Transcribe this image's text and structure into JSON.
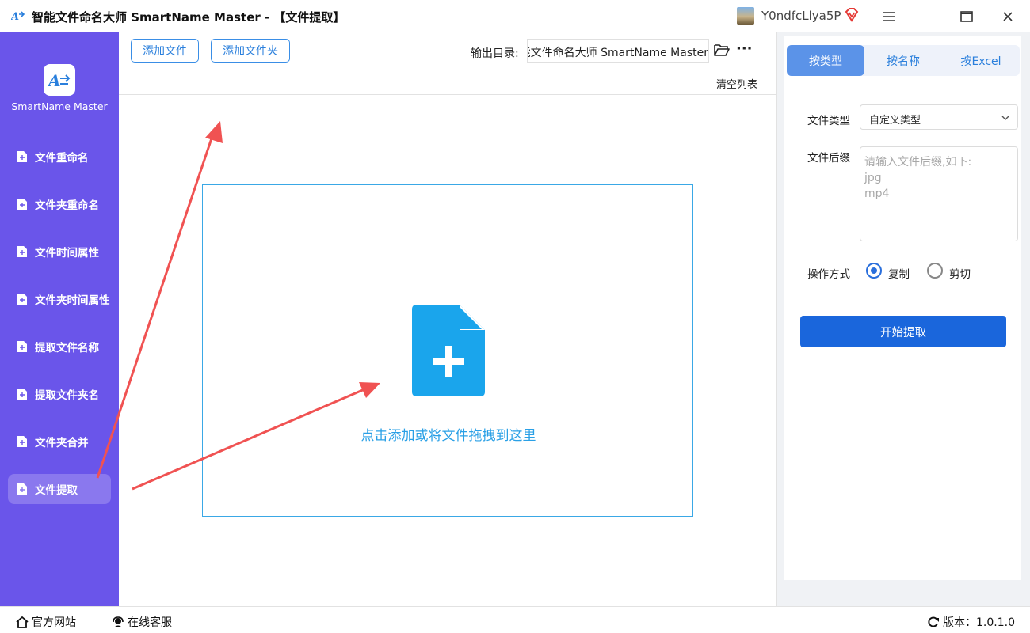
{
  "window": {
    "title": "智能文件命名大师 SmartName Master - 【文件提取】",
    "username": "Y0ndfcLlya5P"
  },
  "sidebar": {
    "brand": "SmartName Master",
    "items": [
      {
        "label": "文件重命名"
      },
      {
        "label": "文件夹重命名"
      },
      {
        "label": "文件时间属性"
      },
      {
        "label": "文件夹时间属性"
      },
      {
        "label": "提取文件名称"
      },
      {
        "label": "提取文件夹名"
      },
      {
        "label": "文件夹合并"
      },
      {
        "label": "文件提取",
        "active": true
      }
    ]
  },
  "toolbar": {
    "add_file": "添加文件",
    "add_folder": "添加文件夹",
    "output_label": "输出目录:",
    "output_path": "能文件命名大师 SmartName Master",
    "clear_list": "清空列表"
  },
  "dropzone": {
    "text": "点击添加或将文件拖拽到这里"
  },
  "right_panel": {
    "tabs": [
      {
        "label": "按类型",
        "active": true
      },
      {
        "label": "按名称"
      },
      {
        "label": "按Excel"
      }
    ],
    "file_type_label": "文件类型",
    "file_type_value": "自定义类型",
    "suffix_label": "文件后缀",
    "suffix_placeholder": "请输入文件后缀,如下:\njpg\nmp4",
    "operation_label": "操作方式",
    "op_copy": "复制",
    "op_cut": "剪切",
    "operation_selected": "复制",
    "start_button": "开始提取"
  },
  "statusbar": {
    "website": "官方网站",
    "support": "在线客服",
    "version": "版本：1.0.1.0"
  },
  "colors": {
    "sidebar": "#6a55ea",
    "accent": "#2a7fdc",
    "primary_button": "#1a66dc",
    "annotation_arrow": "#f05252"
  }
}
